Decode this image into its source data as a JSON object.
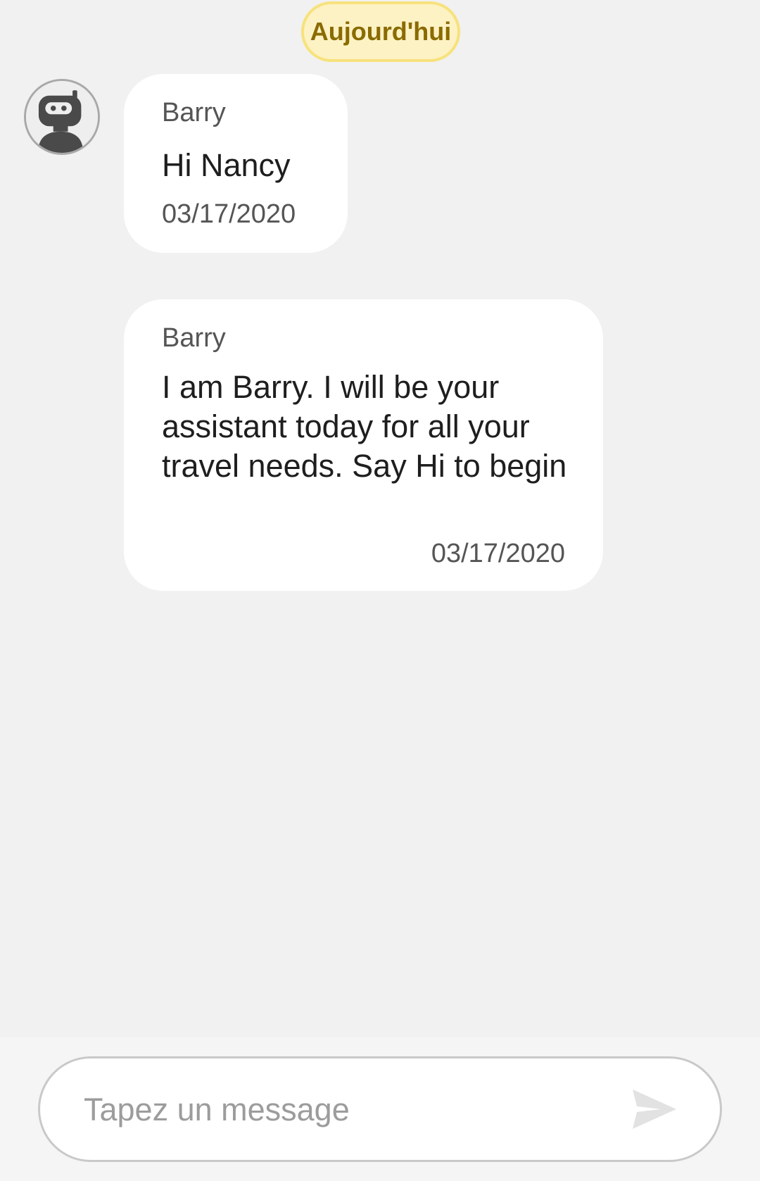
{
  "date_chip": {
    "label": "Aujourd'hui"
  },
  "messages": [
    {
      "sender": "Barry",
      "text": "Hi Nancy",
      "timestamp": "03/17/2020"
    },
    {
      "sender": "Barry",
      "text": "I am Barry. I will be your assistant today for all your travel needs. Say Hi to begin",
      "timestamp": "03/17/2020"
    }
  ],
  "avatar": {
    "icon": "robot-icon"
  },
  "composer": {
    "placeholder": "Tapez un message",
    "value": "",
    "send_icon": "send-icon"
  },
  "colors": {
    "background": "#f1f1f1",
    "bubble": "#ffffff",
    "date_chip_fill": "#fdf2c4",
    "date_chip_border": "#f7e27c",
    "date_chip_text": "#8a6b00"
  }
}
